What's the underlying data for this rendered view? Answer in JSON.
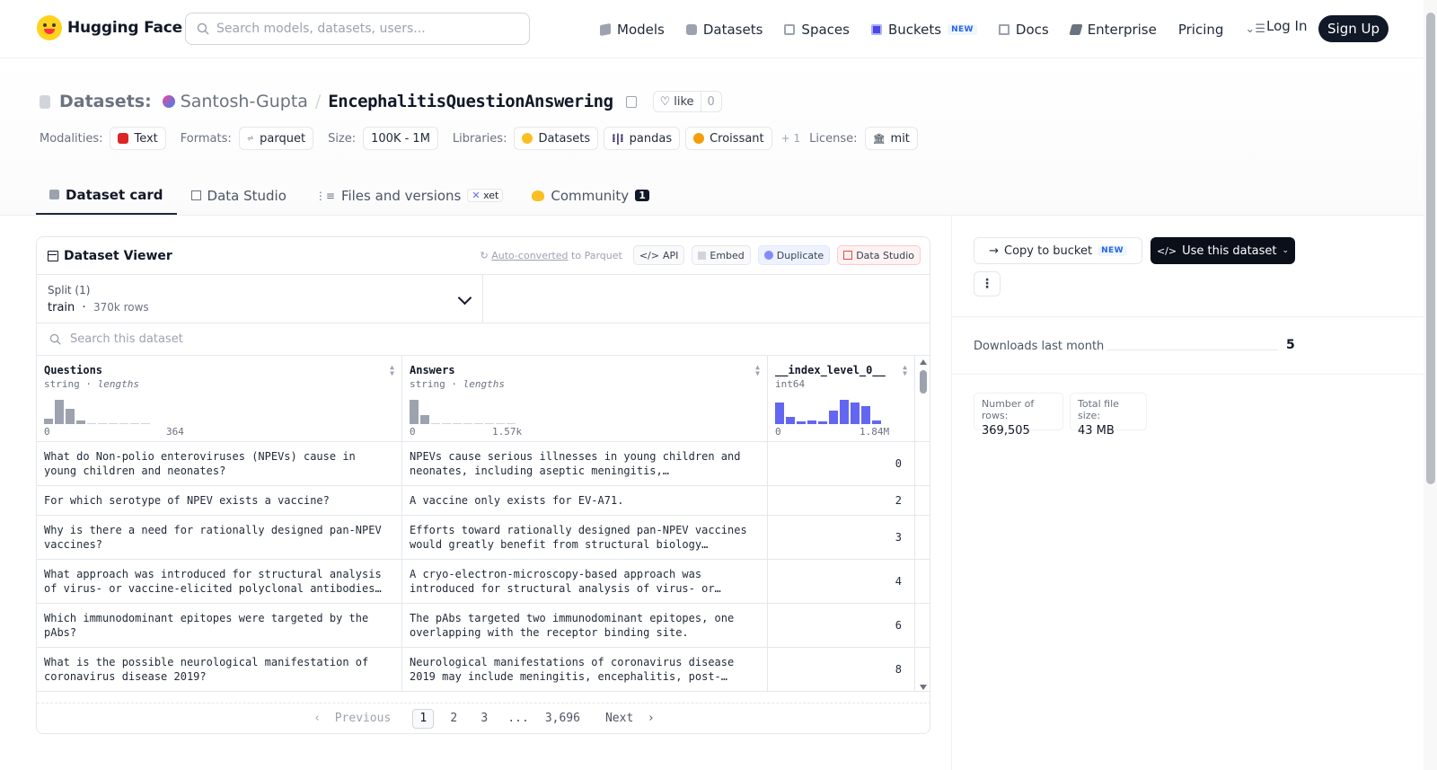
{
  "nav": {
    "brand": "Hugging Face",
    "search_placeholder": "Search models, datasets, users...",
    "links": [
      {
        "label": "Models",
        "icon": "cube-icon"
      },
      {
        "label": "Datasets",
        "icon": "database-icon"
      },
      {
        "label": "Spaces",
        "icon": "grid-icon"
      },
      {
        "label": "Buckets",
        "icon": "bucket-icon",
        "badge": "NEW"
      },
      {
        "label": "Docs",
        "icon": "book-icon"
      },
      {
        "label": "Enterprise",
        "icon": "enterprise-icon"
      },
      {
        "label": "Pricing"
      }
    ],
    "login": "Log In",
    "signup": "Sign Up"
  },
  "header": {
    "section_label": "Datasets:",
    "org": "Santosh-Gupta",
    "separator": "/",
    "name": "EncephalitisQuestionAnswering",
    "like_label": "like",
    "like_count": "0",
    "meta": {
      "modalities_label": "Modalities:",
      "modality": "Text",
      "formats_label": "Formats:",
      "format": "parquet",
      "size_label": "Size:",
      "size": "100K - 1M",
      "libraries_label": "Libraries:",
      "libraries": [
        "Datasets",
        "pandas",
        "Croissant"
      ],
      "libraries_more": "+ 1",
      "license_label": "License:",
      "license": "mit"
    },
    "tabs": [
      {
        "label": "Dataset card",
        "active": true
      },
      {
        "label": "Data Studio"
      },
      {
        "label": "Files and versions",
        "badge": "xet"
      },
      {
        "label": "Community",
        "count": "1"
      }
    ]
  },
  "viewer": {
    "title": "Dataset Viewer",
    "auto_converted_link": "Auto-converted",
    "auto_converted_rest": "to Parquet",
    "actions": [
      "API",
      "Embed",
      "Duplicate",
      "Data Studio"
    ],
    "split_label": "Split (1)",
    "split_value": "train",
    "split_rows": "370k rows",
    "search_placeholder": "Search this dataset",
    "columns": [
      {
        "name": "Questions",
        "type": "string",
        "stat": "lengths",
        "min": "0",
        "max": "364",
        "hist": [
          0.2,
          0.95,
          0.6,
          0.15,
          0,
          0,
          0,
          0,
          0,
          0
        ]
      },
      {
        "name": "Answers",
        "type": "string",
        "stat": "lengths",
        "min": "0",
        "max": "1.57k",
        "hist": [
          0.95,
          0.35,
          0,
          0,
          0,
          0,
          0,
          0,
          0,
          0
        ]
      },
      {
        "name": "__index_level_0__",
        "type": "int64",
        "stat": "",
        "min": "0",
        "max": "1.84M",
        "hist": [
          0.85,
          0.3,
          0.12,
          0.15,
          0.1,
          0.55,
          0.95,
          0.85,
          0.7,
          0.15
        ]
      }
    ],
    "rows": [
      {
        "q": "What do Non-polio enteroviruses (NPEVs) cause in young children and neonates?",
        "a": "NPEVs cause serious illnesses in young children and neonates, including aseptic meningitis, encephalitis,…",
        "i": "0"
      },
      {
        "q": "For which serotype of NPEV exists a vaccine?",
        "a": "A vaccine only exists for EV-A71.",
        "i": "2"
      },
      {
        "q": "Why is there a need for rationally designed pan-NPEV vaccines?",
        "a": "Efforts toward rationally designed pan-NPEV vaccines would greatly benefit from structural biology methods…",
        "i": "3"
      },
      {
        "q": "What approach was introduced for structural analysis of virus- or vaccine-elicited polyclonal antibodies…",
        "a": "A cryo-electron-microscopy-based approach was introduced for structural analysis of virus- or…",
        "i": "4"
      },
      {
        "q": "Which immunodominant epitopes were targeted by the pAbs?",
        "a": "The pAbs targeted two immunodominant epitopes, one overlapping with the receptor binding site.",
        "i": "6"
      },
      {
        "q": "What is the possible neurological manifestation of coronavirus disease 2019?",
        "a": "Neurological manifestations of coronavirus disease 2019 may include meningitis, encephalitis, post-…",
        "i": "8"
      }
    ],
    "pager": {
      "prev": "Previous",
      "pages": [
        "1",
        "2",
        "3",
        "...",
        "3,696"
      ],
      "next": "Next"
    }
  },
  "sidebar": {
    "copy_to_bucket": "Copy to bucket",
    "copy_badge": "NEW",
    "use_dataset": "Use this dataset",
    "more": "⋮",
    "downloads_label": "Downloads last month",
    "downloads_value": "5",
    "stats": [
      {
        "label": "Number of rows:",
        "value": "369,505"
      },
      {
        "label": "Total file size:",
        "value": "43 MB"
      }
    ]
  }
}
